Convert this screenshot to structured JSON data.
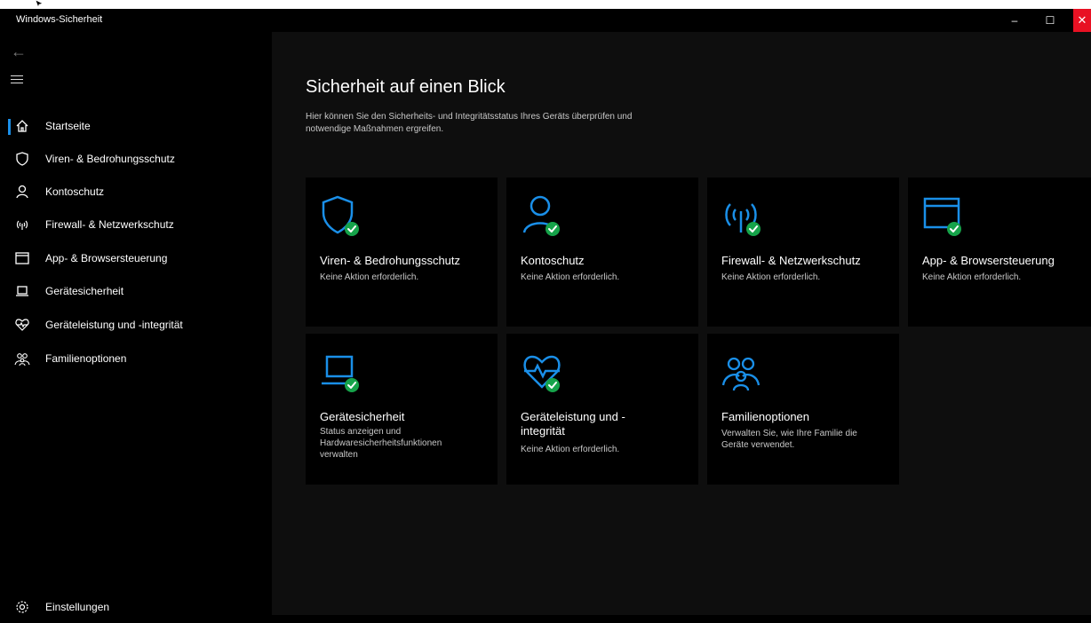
{
  "window": {
    "title": "Windows-Sicherheit",
    "minimize_glyph": "–",
    "maximize_glyph": "☐",
    "close_glyph": "✕"
  },
  "colors": {
    "accent": "#1a8fe8",
    "ok_badge": "#16a34a",
    "close_button": "#e81123"
  },
  "sidebar": {
    "items": [
      {
        "label": "Startseite",
        "icon": "home-icon",
        "selected": true
      },
      {
        "label": "Viren- & Bedrohungsschutz",
        "icon": "shield-icon"
      },
      {
        "label": "Kontoschutz",
        "icon": "person-icon"
      },
      {
        "label": "Firewall- & Netzwerkschutz",
        "icon": "antenna-icon"
      },
      {
        "label": "App- & Browsersteuerung",
        "icon": "browser-window-icon"
      },
      {
        "label": "Gerätesicherheit",
        "icon": "laptop-icon"
      },
      {
        "label": "Geräteleistung und -integrität",
        "icon": "heart-pulse-icon"
      },
      {
        "label": "Familienoptionen",
        "icon": "family-icon"
      }
    ],
    "settings_label": "Einstellungen"
  },
  "main": {
    "title": "Sicherheit auf einen Blick",
    "description": "Hier können Sie den Sicherheits- und Integritätsstatus Ihres Geräts überprüfen und notwendige Maßnahmen ergreifen.",
    "tiles": [
      {
        "name": "Viren- & Bedrohungsschutz",
        "status": "Keine Aktion erforderlich.",
        "icon": "shield-icon"
      },
      {
        "name": "Kontoschutz",
        "status": "Keine Aktion erforderlich.",
        "icon": "person-icon"
      },
      {
        "name": "Firewall- & Netzwerkschutz",
        "status": "Keine Aktion erforderlich.",
        "icon": "antenna-icon"
      },
      {
        "name": "App- & Browsersteuerung",
        "status": "Keine Aktion erforderlich.",
        "icon": "browser-window-icon"
      },
      {
        "name": "Gerätesicherheit",
        "status": "Status anzeigen und Hardwaresicherheitsfunktionen verwalten",
        "icon": "laptop-icon"
      },
      {
        "name": "Geräteleistung und -integrität",
        "status": "Keine Aktion erforderlich.",
        "icon": "heart-pulse-icon"
      },
      {
        "name": "Familienoptionen",
        "status": "Verwalten Sie, wie Ihre Familie die Geräte verwendet.",
        "icon": "family-icon"
      }
    ]
  }
}
